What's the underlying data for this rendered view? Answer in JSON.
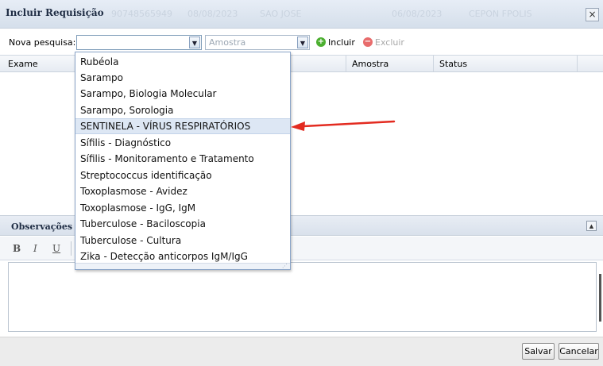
{
  "window": {
    "title": "Incluir Requisição",
    "background_fields": [
      "90748565949",
      "08/08/2023",
      "SAO JOSE",
      "06/08/2023",
      "CEPON FPOLIS"
    ],
    "close_label": "×"
  },
  "search": {
    "label": "Nova pesquisa:",
    "value": "",
    "amostra_placeholder": "Amostra",
    "incluir_label": "Incluir",
    "excluir_label": "Excluir"
  },
  "grid": {
    "columns": [
      "Exame",
      "Amostra",
      "Status"
    ]
  },
  "dropdown": {
    "options": [
      "Rubéola",
      "Sarampo",
      "Sarampo, Biologia Molecular",
      "Sarampo, Sorologia",
      "SENTINELA - VÍRUS RESPIRATÓRIOS",
      "Sífilis - Diagnóstico",
      "Sífilis - Monitoramento e Tratamento",
      "Streptococcus identificação",
      "Toxoplasmose - Avidez",
      "Toxoplasmose - IgG, IgM",
      "Tuberculose - Baciloscopia",
      "Tuberculose - Cultura",
      "Zika - Detecção anticorpos IgM/IgG"
    ],
    "highlighted_index": 4
  },
  "observacoes": {
    "title": "Observações",
    "format_buttons": [
      "B",
      "I",
      "U"
    ]
  },
  "footer": {
    "save_label": "Salvar",
    "cancel_label": "Cancelar"
  },
  "colors": {
    "arrow": "#e32b20",
    "highlight": "#dde7f4",
    "incluir_icon": "#4caf30",
    "excluir_icon": "#e86c6c"
  },
  "icons": {
    "select_arrow": "chevron-down-icon",
    "incluir": "plus-circle-icon",
    "excluir": "minus-circle-icon",
    "close": "close-icon",
    "collapse": "chevron-up-icon",
    "annotation": "red-arrow-icon"
  }
}
